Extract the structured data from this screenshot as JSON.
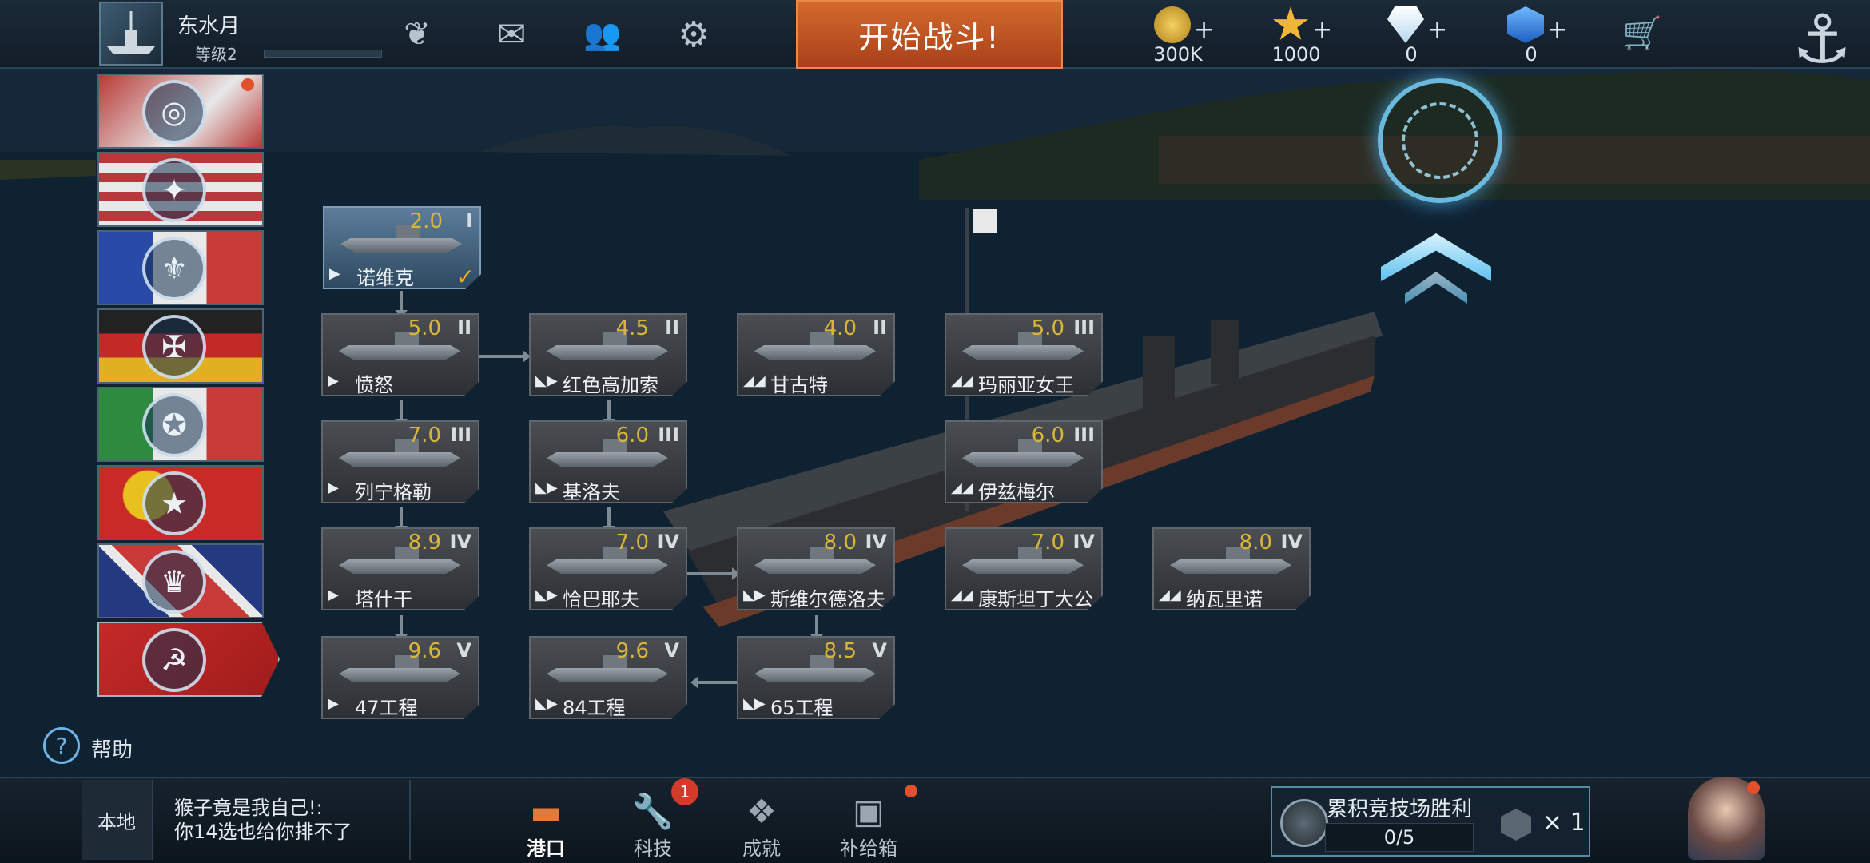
{
  "player": {
    "name": "东水月",
    "level_label": "等级2"
  },
  "topbar": {
    "battle_button": "开始战斗!",
    "currencies": [
      {
        "icon": "gold-coin-icon",
        "value": "300K",
        "color": "#e0b030"
      },
      {
        "icon": "star-icon",
        "value": "1000",
        "color": "#f0b63a"
      },
      {
        "icon": "diamond-icon",
        "value": "0",
        "color": "#e8f4ff"
      },
      {
        "icon": "blue-gem-icon",
        "value": "0",
        "color": "#3a8ee8"
      }
    ],
    "plus_label": "+"
  },
  "nations": [
    {
      "name": "japan",
      "emblem": "japan-emblem-icon",
      "glyph": "◎",
      "flag": "linear-gradient(135deg,#b83a36,#e8e8e8 60%,#b83a36)",
      "has_notification": true
    },
    {
      "name": "usa",
      "emblem": "eagle-emblem-icon",
      "glyph": "✦",
      "flag": "repeating-linear-gradient(180deg,#b8393b 0 12px,#e8e8e8 12px 24px)"
    },
    {
      "name": "france",
      "emblem": "fleur-de-lis-emblem-icon",
      "glyph": "⚜",
      "flag": "linear-gradient(90deg,#2a4aa8 0 33%,#e8e8e8 33% 66%,#c83a38 66%)"
    },
    {
      "name": "germany",
      "emblem": "iron-cross-emblem-icon",
      "glyph": "✠",
      "flag": "linear-gradient(180deg,#222 0 33%,#c22a28 33% 66%,#e0b020 66%)"
    },
    {
      "name": "italy",
      "emblem": "star-emblem-icon",
      "glyph": "✪",
      "flag": "linear-gradient(90deg,#2d8a3e 0 33%,#e8e8e8 33% 66%,#c83a38 66%)"
    },
    {
      "name": "china",
      "emblem": "china-emblem-icon",
      "glyph": "★",
      "flag": "radial-gradient(circle at 30% 40%,#e8c020 0 20%,#c82a26 21%)"
    },
    {
      "name": "uk",
      "emblem": "crown-emblem-icon",
      "glyph": "♛",
      "flag": "linear-gradient(45deg,#233a80 30%,#e8e8e8 30% 36%,#c83a38 36% 64%,#e8e8e8 64% 70%,#233a80 70%)"
    },
    {
      "name": "ussr",
      "emblem": "hammer-sickle-emblem-icon",
      "glyph": "☭",
      "flag": "linear-gradient(135deg,#c42a28,#a01c1c)",
      "selected": true
    }
  ],
  "help": {
    "label": "帮助"
  },
  "ships": [
    {
      "name": "诺维克",
      "score": "2.0",
      "tier": "I",
      "type": "destroyer",
      "type_glyph": "▶",
      "owned": true
    },
    {
      "name": "愤怒",
      "score": "5.0",
      "tier": "II",
      "type": "destroyer",
      "type_glyph": "▶"
    },
    {
      "name": "红色高加索",
      "score": "4.5",
      "tier": "II",
      "type": "cruiser",
      "type_glyph": "◣▶"
    },
    {
      "name": "甘古特",
      "score": "4.0",
      "tier": "II",
      "type": "battleship",
      "type_glyph": "◢◢"
    },
    {
      "name": "玛丽亚女王",
      "score": "5.0",
      "tier": "III",
      "type": "battleship",
      "type_glyph": "◢◢"
    },
    {
      "name": "列宁格勒",
      "score": "7.0",
      "tier": "III",
      "type": "destroyer",
      "type_glyph": "▶"
    },
    {
      "name": "基洛夫",
      "score": "6.0",
      "tier": "III",
      "type": "cruiser",
      "type_glyph": "◣▶"
    },
    {
      "name": "伊兹梅尔",
      "score": "6.0",
      "tier": "III",
      "type": "battleship",
      "type_glyph": "◢◢"
    },
    {
      "name": "塔什干",
      "score": "8.9",
      "tier": "IV",
      "type": "destroyer",
      "type_glyph": "▶"
    },
    {
      "name": "恰巴耶夫",
      "score": "7.0",
      "tier": "IV",
      "type": "cruiser",
      "type_glyph": "◣▶"
    },
    {
      "name": "斯维尔德洛夫",
      "score": "8.0",
      "tier": "IV",
      "type": "cruiser",
      "type_glyph": "◣▶"
    },
    {
      "name": "康斯坦丁大公",
      "score": "7.0",
      "tier": "IV",
      "type": "battleship",
      "type_glyph": "◢◢"
    },
    {
      "name": "纳瓦里诺",
      "score": "8.0",
      "tier": "IV",
      "type": "battleship",
      "type_glyph": "◢◢"
    },
    {
      "name": "47工程",
      "score": "9.6",
      "tier": "V",
      "type": "destroyer",
      "type_glyph": "▶"
    },
    {
      "name": "84工程",
      "score": "9.6",
      "tier": "V",
      "type": "cruiser",
      "type_glyph": "◣▶"
    },
    {
      "name": "65工程",
      "score": "8.5",
      "tier": "V",
      "type": "cruiser",
      "type_glyph": "◣▶"
    }
  ],
  "chat": {
    "channel": "本地",
    "message_line1": "猴子竟是我自己!:",
    "message_line2": "你14选也给你排不了"
  },
  "bottom_nav": [
    {
      "label": "港口",
      "icon": "port-icon",
      "active": true
    },
    {
      "label": "科技",
      "icon": "tech-wrench-icon",
      "badge": "1"
    },
    {
      "label": "成就",
      "icon": "achievement-wings-icon"
    },
    {
      "label": "补给箱",
      "icon": "supply-crate-icon",
      "has_notification": true
    }
  ],
  "arena": {
    "title": "累积竞技场胜利",
    "progress": "0/5",
    "reward_count": "× 1"
  }
}
